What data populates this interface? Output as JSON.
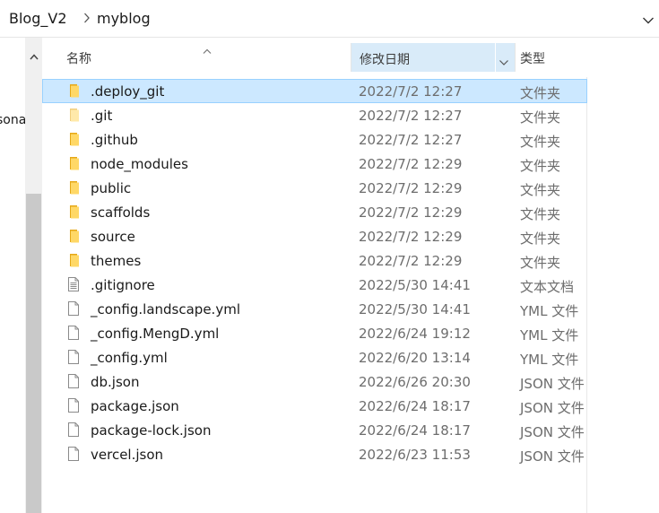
{
  "breadcrumb": {
    "parent": "Blog_V2",
    "current": "myblog"
  },
  "nav": {
    "partial_label": "sona"
  },
  "columns": {
    "name": "名称",
    "date": "修改日期",
    "type": "类型"
  },
  "files": [
    {
      "name": ".deploy_git",
      "date": "2022/7/2 12:27",
      "type": "文件夹",
      "icon": "folder-icon",
      "selected": true
    },
    {
      "name": ".git",
      "date": "2022/7/2 12:27",
      "type": "文件夹",
      "icon": "folder-icon",
      "faded": true
    },
    {
      "name": ".github",
      "date": "2022/7/2 12:27",
      "type": "文件夹",
      "icon": "folder-icon"
    },
    {
      "name": "node_modules",
      "date": "2022/7/2 12:29",
      "type": "文件夹",
      "icon": "folder-icon"
    },
    {
      "name": "public",
      "date": "2022/7/2 12:29",
      "type": "文件夹",
      "icon": "folder-icon"
    },
    {
      "name": "scaffolds",
      "date": "2022/7/2 12:29",
      "type": "文件夹",
      "icon": "folder-icon"
    },
    {
      "name": "source",
      "date": "2022/7/2 12:29",
      "type": "文件夹",
      "icon": "folder-icon"
    },
    {
      "name": "themes",
      "date": "2022/7/2 12:29",
      "type": "文件夹",
      "icon": "folder-icon"
    },
    {
      "name": ".gitignore",
      "date": "2022/5/30 14:41",
      "type": "文本文档",
      "icon": "text-file-icon"
    },
    {
      "name": "_config.landscape.yml",
      "date": "2022/5/30 14:41",
      "type": "YML 文件",
      "icon": "file-icon"
    },
    {
      "name": "_config.MengD.yml",
      "date": "2022/6/24 19:12",
      "type": "YML 文件",
      "icon": "file-icon"
    },
    {
      "name": "_config.yml",
      "date": "2022/6/20 13:14",
      "type": "YML 文件",
      "icon": "file-icon"
    },
    {
      "name": "db.json",
      "date": "2022/6/26 20:30",
      "type": "JSON 文件",
      "icon": "file-icon"
    },
    {
      "name": "package.json",
      "date": "2022/6/24 18:17",
      "type": "JSON 文件",
      "icon": "file-icon"
    },
    {
      "name": "package-lock.json",
      "date": "2022/6/24 18:17",
      "type": "JSON 文件",
      "icon": "file-icon"
    },
    {
      "name": "vercel.json",
      "date": "2022/6/23 11:53",
      "type": "JSON 文件",
      "icon": "file-icon"
    }
  ],
  "colors": {
    "selection": "#cce8ff",
    "selection_border": "#99d1ff",
    "header_active": "#d9ebf9",
    "folder": "#f7c948"
  }
}
